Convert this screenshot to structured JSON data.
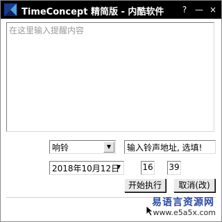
{
  "window": {
    "title": "TimeConcept 精简版 - 内酷软件",
    "controls": {
      "help": "?",
      "minimize": "—",
      "close": "×"
    }
  },
  "reminder": {
    "placeholder": "在这里输入提醒内容"
  },
  "ring": {
    "selected": "响铃",
    "url_hint": "输入铃声地址, 选填!"
  },
  "schedule": {
    "date": "2018年10月12日",
    "hour": "16",
    "minute": "39"
  },
  "buttons": {
    "start": "开始执行",
    "cancel": "取消(改)"
  },
  "watermark": {
    "cn": "易语言资源网",
    "url": "www.e5a5x.com"
  },
  "colors": {
    "titlebar": "#000000",
    "watermark_blue": "#2a4aa8"
  }
}
